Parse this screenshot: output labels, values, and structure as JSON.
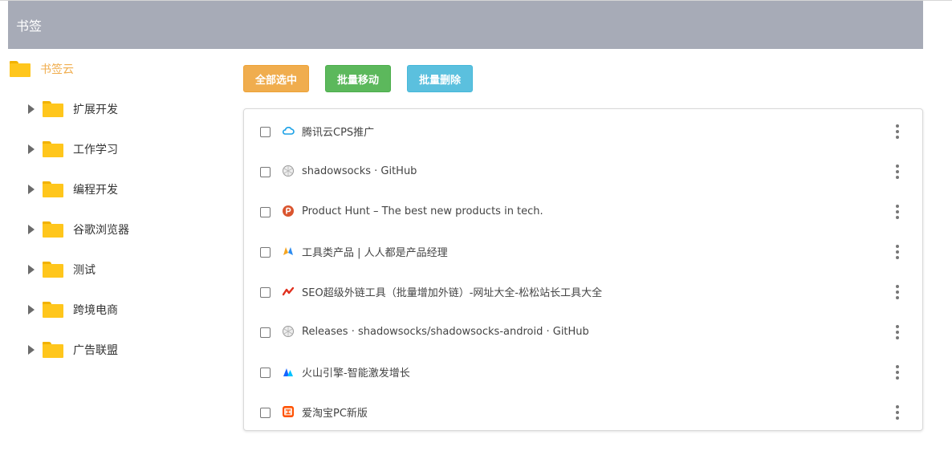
{
  "header": {
    "title": "书签"
  },
  "sidebar": {
    "root": {
      "label": "书签云"
    },
    "items": [
      {
        "label": "扩展开发"
      },
      {
        "label": "工作学习"
      },
      {
        "label": "编程开发"
      },
      {
        "label": "谷歌浏览器"
      },
      {
        "label": "测试"
      },
      {
        "label": "跨境电商"
      },
      {
        "label": "广告联盟"
      }
    ]
  },
  "toolbar": {
    "select_all_label": "全部选中",
    "batch_move_label": "批量移动",
    "batch_delete_label": "批量删除"
  },
  "bookmarks": [
    {
      "title": "腾讯云CPS推广",
      "icon": "tencent-cloud-icon"
    },
    {
      "title": "shadowsocks · GitHub",
      "icon": "globe-icon"
    },
    {
      "title": "Product Hunt – The best new products in tech.",
      "icon": "product-hunt-icon"
    },
    {
      "title": "工具类产品 | 人人都是产品经理",
      "icon": "woshipm-icon"
    },
    {
      "title": "SEO超级外链工具（批量增加外链）-网址大全-松松站长工具大全",
      "icon": "seo-link-icon"
    },
    {
      "title": "Releases · shadowsocks/shadowsocks-android · GitHub",
      "icon": "globe-icon"
    },
    {
      "title": "火山引擎-智能激发增长",
      "icon": "volcengine-icon"
    },
    {
      "title": "爱淘宝PC新版",
      "icon": "taobao-icon"
    }
  ],
  "colors": {
    "header_bg": "#a7abb7",
    "accent_orange": "#f0ad4e",
    "accent_green": "#5cb85c",
    "accent_blue": "#5bc0de",
    "folder": "#ffc61c"
  }
}
